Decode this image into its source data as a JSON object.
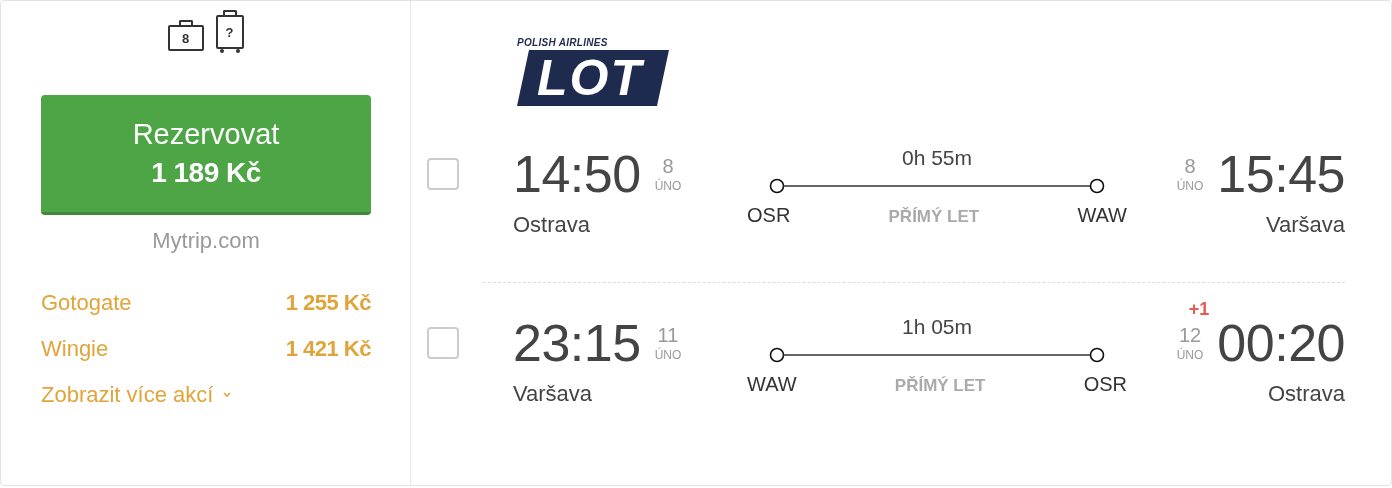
{
  "baggage": [
    {
      "kind": "cabin",
      "label": "8"
    },
    {
      "kind": "trolley",
      "label": "?"
    }
  ],
  "book_button": {
    "label": "Rezervovat",
    "price": "1 189 Kč"
  },
  "provider": "Mytrip.com",
  "other_offers": [
    {
      "name": "Gotogate",
      "price": "1 255 Kč"
    },
    {
      "name": "Wingie",
      "price": "1 421 Kč"
    }
  ],
  "more_link": "Zobrazit více akcí",
  "airline": {
    "tagline": "POLISH AIRLINES",
    "name": "LOT"
  },
  "flights": [
    {
      "selected": false,
      "departure": {
        "time": "14:50",
        "day": "8",
        "month": "ÚNO",
        "city": "Ostrava"
      },
      "duration": "0h 55m",
      "from_code": "OSR",
      "stop_label": "PŘÍMÝ LET",
      "to_code": "WAW",
      "arrival": {
        "time": "15:45",
        "day": "8",
        "month": "ÚNO",
        "city": "Varšava"
      }
    },
    {
      "selected": false,
      "departure": {
        "time": "23:15",
        "day": "11",
        "month": "ÚNO",
        "city": "Varšava"
      },
      "duration": "1h 05m",
      "from_code": "WAW",
      "stop_label": "PŘÍMÝ LET",
      "to_code": "OSR",
      "arrival": {
        "time": "00:20",
        "day": "12",
        "month": "ÚNO",
        "city": "Ostrava",
        "day_offset": "+1"
      }
    }
  ]
}
